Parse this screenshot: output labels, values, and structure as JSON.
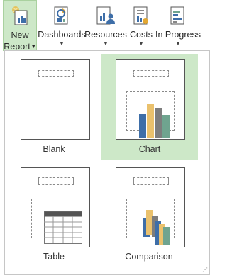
{
  "ribbon": {
    "buttons": [
      {
        "line1": "New",
        "line2": "Report"
      },
      {
        "label": "Dashboards"
      },
      {
        "label": "Resources"
      },
      {
        "label": "Costs"
      },
      {
        "label": "In Progress"
      }
    ]
  },
  "gallery": {
    "items": [
      {
        "label": "Blank"
      },
      {
        "label": "Chart"
      },
      {
        "label": "Table"
      },
      {
        "label": "Comparison"
      }
    ]
  },
  "colors": {
    "selected_bg": "#cde8c8",
    "bar_blue": "#3e6ea8",
    "bar_yellow": "#eac16d",
    "bar_gray": "#7d7d7d",
    "bar_teal": "#6fa48f"
  },
  "icons": [
    "new-report-icon",
    "dashboards-icon",
    "resources-icon",
    "costs-icon",
    "in-progress-icon"
  ]
}
